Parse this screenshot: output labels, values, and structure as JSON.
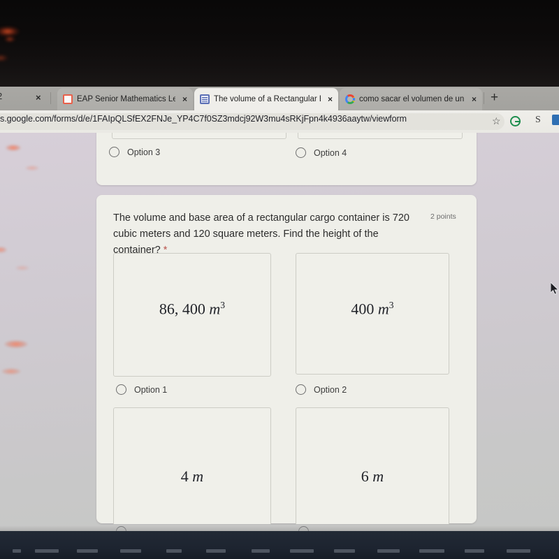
{
  "browser": {
    "left_edge_label": "2",
    "tabs": [
      {
        "title": "EAP Senior Mathematics Lesso",
        "favicon": "slides-icon",
        "active": false,
        "close_label": "×"
      },
      {
        "title": "The volume of a Rectangular B",
        "favicon": "forms-icon",
        "active": true,
        "close_label": "×"
      },
      {
        "title": "como sacar el volumen de un p",
        "favicon": "google-icon",
        "active": false,
        "close_label": "×"
      }
    ],
    "new_tab_label": "+",
    "url": "s.google.com/forms/d/e/1FAIpQLSfEX2FNJe_YP4C7f0SZ3mdcj92W3mu4sRKjFpn4k4936aaytw/viewform",
    "toolbar_icons": [
      {
        "name": "bookmark-star-icon",
        "glyph": "☆"
      },
      {
        "name": "grammarly-extension-icon",
        "glyph": ""
      },
      {
        "name": "s-extension-icon",
        "glyph": "S"
      },
      {
        "name": "edge-extension-icon",
        "glyph": ""
      }
    ]
  },
  "form": {
    "previous_question_options": [
      {
        "label": "Option 3"
      },
      {
        "label": "Option 4"
      }
    ],
    "question": {
      "text_line1": "The volume and base area of a rectangular cargo container is 720 cubic",
      "text_line2": "meters and 120 square meters. Find the height of the container?",
      "required_marker": "*",
      "points": "2 points"
    },
    "options": [
      {
        "image_text": "86, 400",
        "image_unit": "m",
        "image_exp": "3",
        "label": "Option 1"
      },
      {
        "image_text": "400",
        "image_unit": "m",
        "image_exp": "3",
        "label": "Option 2"
      },
      {
        "image_text": "4",
        "image_unit": "m",
        "image_exp": "",
        "label": ""
      },
      {
        "image_text": "6",
        "image_unit": "m",
        "image_exp": "",
        "label": ""
      }
    ]
  },
  "colors": {
    "card_bg": "#efefe9",
    "page_bg": "#d2ccd4",
    "accent_required": "#b9554d",
    "taskbar": "#1d2430"
  }
}
